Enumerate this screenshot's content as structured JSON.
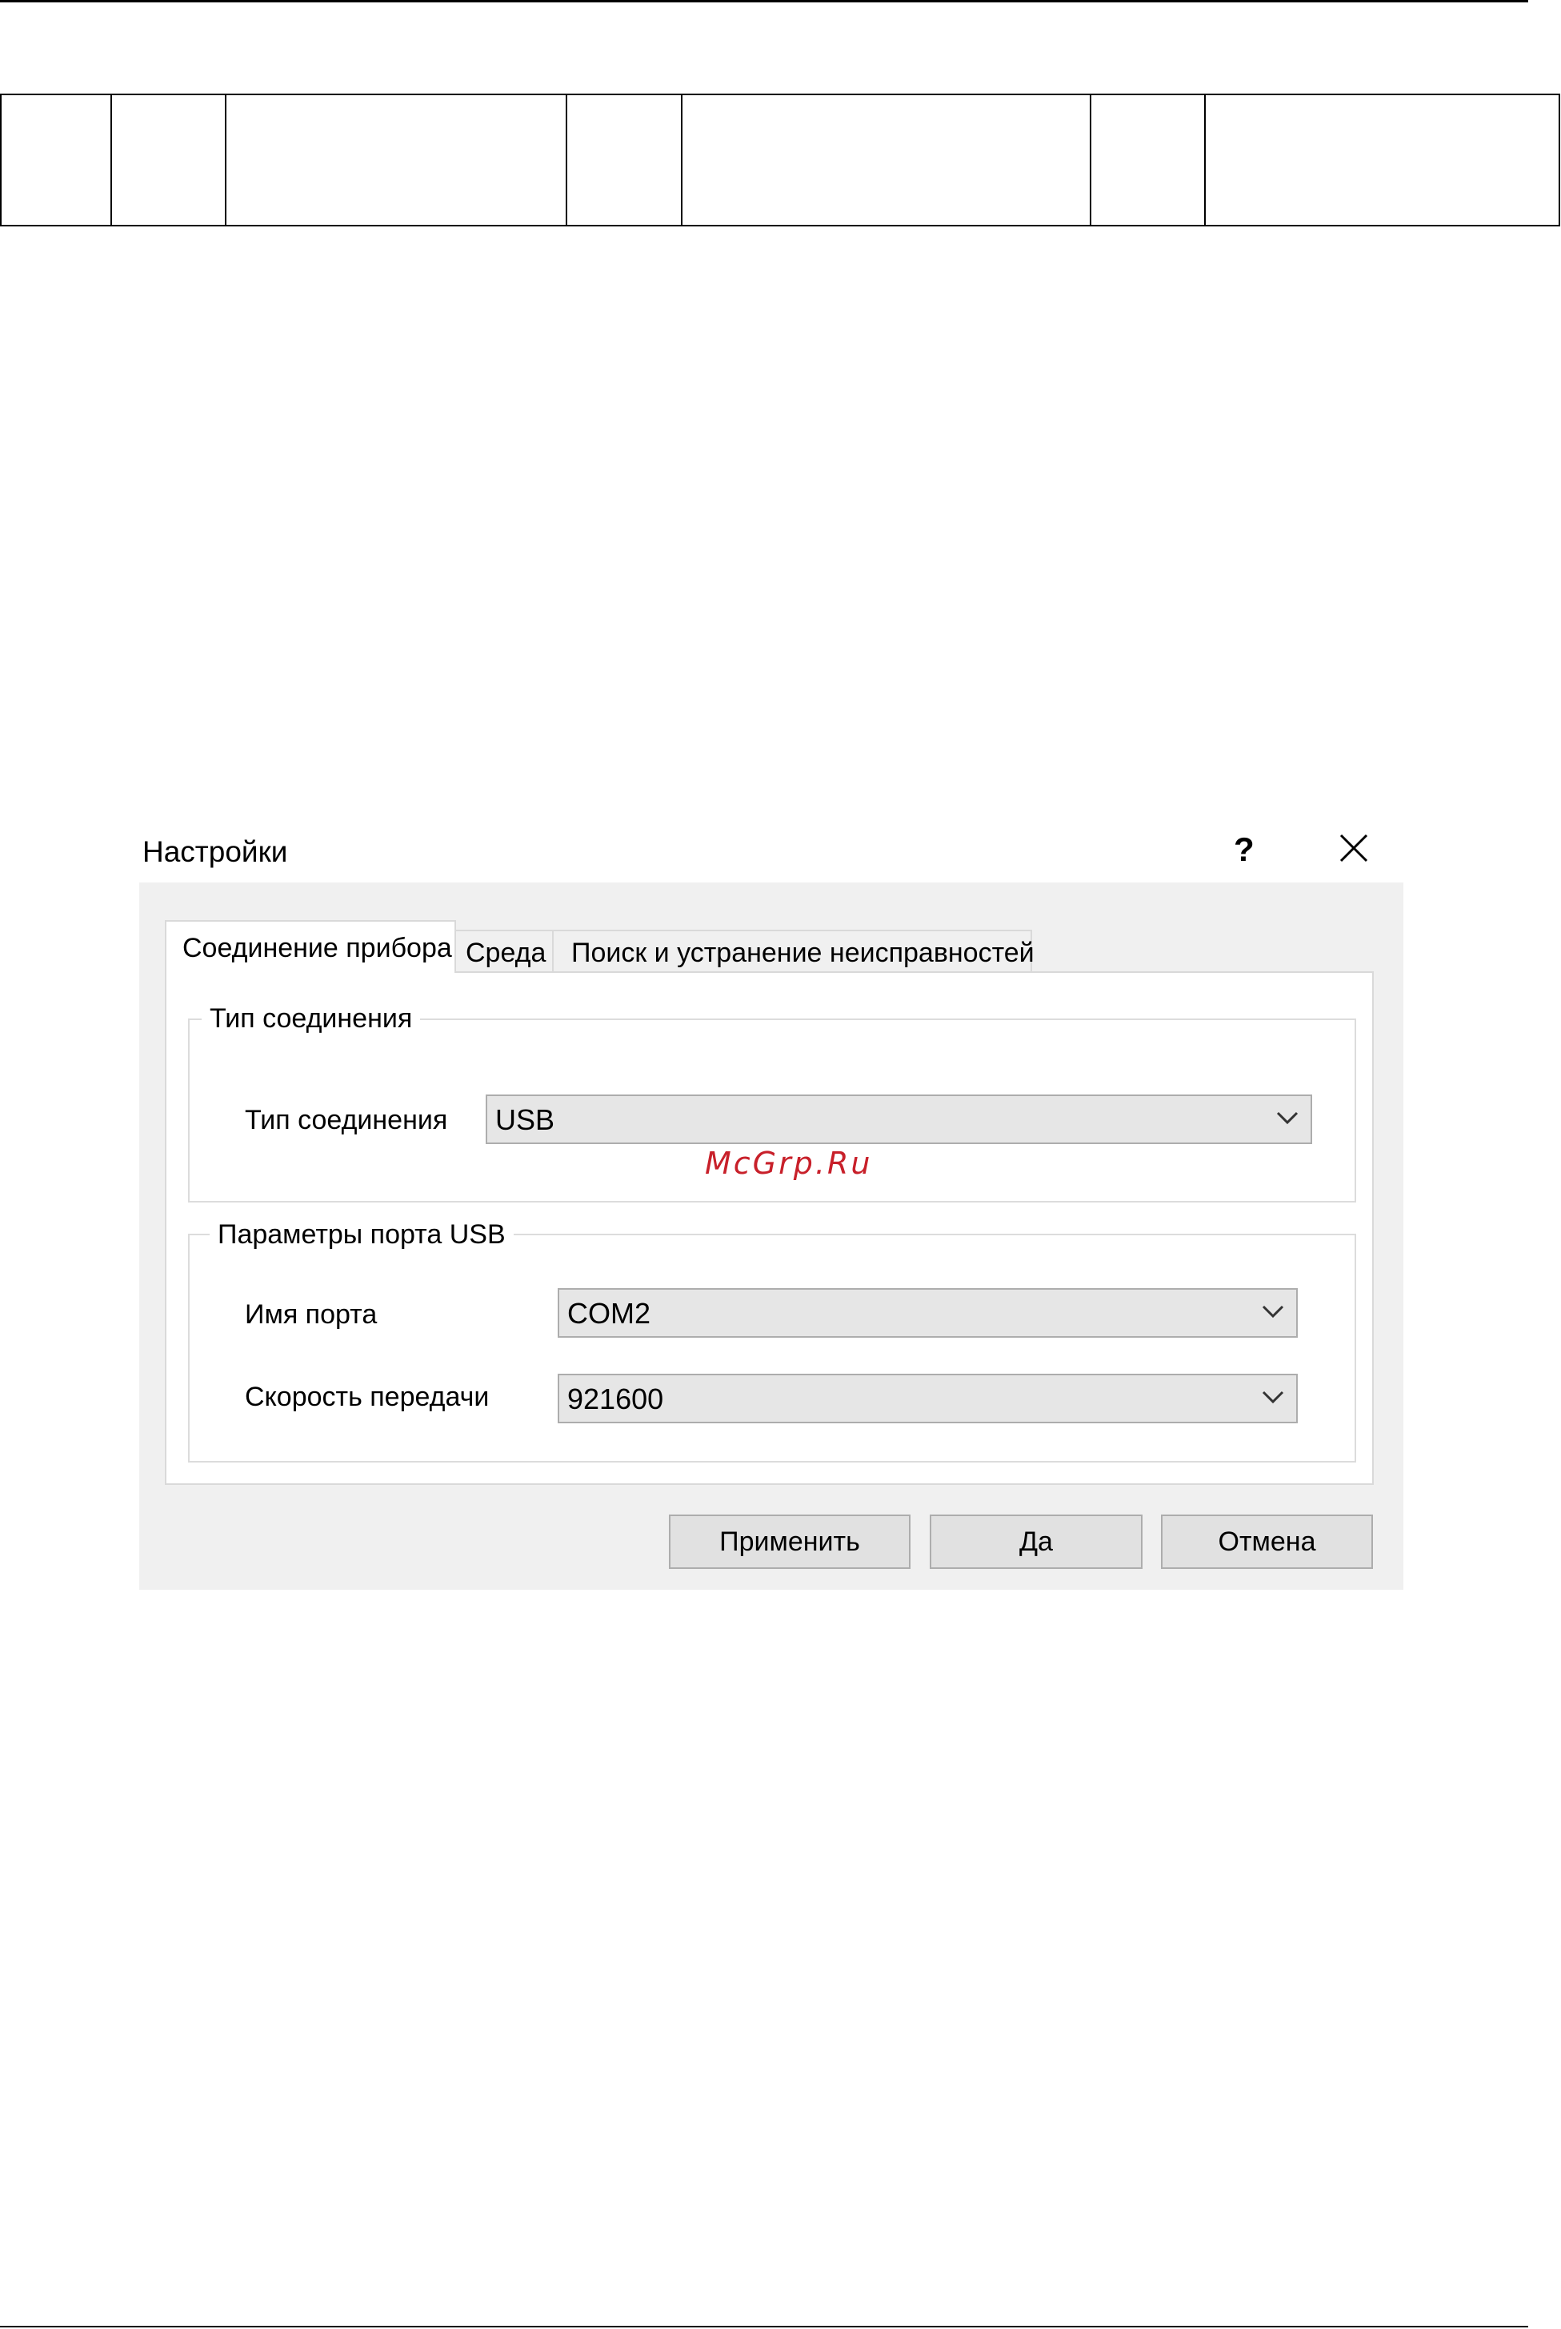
{
  "dialog": {
    "title": "Настройки",
    "help_label": "?",
    "tabs": [
      {
        "label": "Соединение прибора",
        "active": true
      },
      {
        "label": "Среда",
        "active": false
      },
      {
        "label": "Поиск и устранение неисправностей",
        "active": false
      }
    ],
    "connection_group": {
      "legend": "Тип соединения",
      "label": "Тип соединения",
      "value": "USB"
    },
    "port_group": {
      "legend": "Параметры порта USB",
      "port_label": "Имя порта",
      "port_value": "COM2",
      "baud_label": "Скорость передачи",
      "baud_value": "921600"
    },
    "buttons": {
      "apply": "Применить",
      "ok": "Да",
      "cancel": "Отмена"
    }
  },
  "watermark": "McGrp.Ru",
  "icons": {
    "close": "close-icon",
    "dropdown": "chevron-down-icon"
  },
  "colors": {
    "dialog_bg": "#f0f0f0",
    "combo_bg": "#e6e6e6",
    "button_bg": "#e1e1e1",
    "watermark": "#c8202a"
  }
}
